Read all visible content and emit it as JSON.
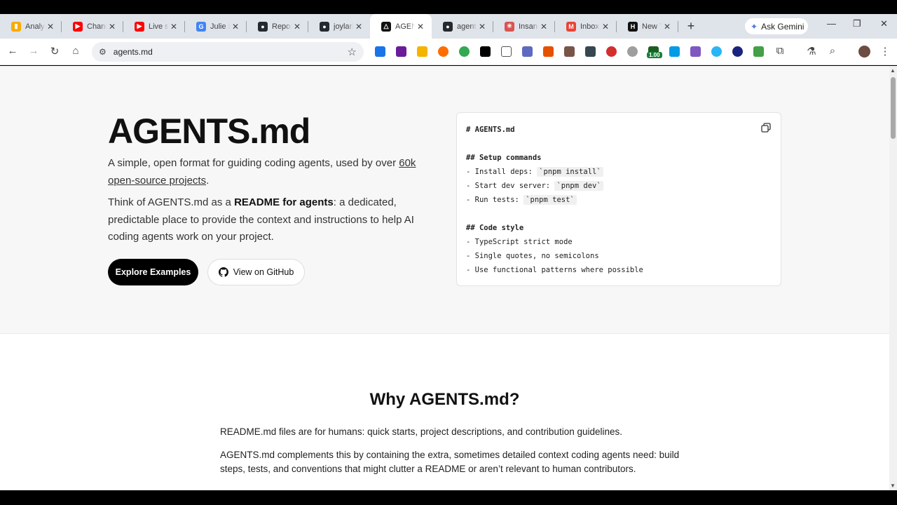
{
  "browser": {
    "tabs": [
      {
        "title": "Analytics",
        "color": "#f9ab00",
        "glyph": "▮"
      },
      {
        "title": "Channel",
        "color": "#ff0000",
        "glyph": "▶"
      },
      {
        "title": "Live stream",
        "color": "#ff0000",
        "glyph": "▶"
      },
      {
        "title": "Julie ID",
        "color": "#4285f4",
        "glyph": "G"
      },
      {
        "title": "Repository",
        "color": "#24292f",
        "glyph": "●"
      },
      {
        "title": "joylark",
        "color": "#24292f",
        "glyph": "●"
      },
      {
        "title": "AGENTS.md",
        "color": "#111111",
        "glyph": "△"
      },
      {
        "title": "agents",
        "color": "#24292f",
        "glyph": "●"
      },
      {
        "title": "Insane",
        "color": "#d9534f",
        "glyph": "✳"
      },
      {
        "title": "Inbox",
        "color": "#ea4335",
        "glyph": "M"
      },
      {
        "title": "New Tab",
        "color": "#111111",
        "glyph": "H"
      }
    ],
    "active_tab": 6,
    "ask_gemini_label": "Ask Gemini",
    "url": "agents.md",
    "extension_badge": "1.00"
  },
  "hero": {
    "title": "AGENTS.md",
    "lead_before_link": "A simple, open format for guiding coding agents, used by over ",
    "lead_link": "60k open-source projects",
    "lead_after_link": ".",
    "desc_before_bold": "Think of AGENTS.md as a ",
    "desc_bold": "README for agents",
    "desc_after_bold": ": a dedicated, predictable place to provide the context and instructions to help AI coding agents work on your project.",
    "primary_button": "Explore Examples",
    "secondary_button": "View on GitHub"
  },
  "code_sample": {
    "heading": "# AGENTS.md",
    "setup_heading": "## Setup commands",
    "setup_items": [
      {
        "prefix": "- Install deps: ",
        "code": "`pnpm install`"
      },
      {
        "prefix": "- Start dev server: ",
        "code": "`pnpm dev`"
      },
      {
        "prefix": "- Run tests: ",
        "code": "`pnpm test`"
      }
    ],
    "style_heading": "## Code style",
    "style_items": [
      "- TypeScript strict mode",
      "- Single quotes, no semicolons",
      "- Use functional patterns where possible"
    ]
  },
  "why": {
    "title": "Why AGENTS.md?",
    "p1": "README.md files are for humans: quick starts, project descriptions, and contribution guidelines.",
    "p2": "AGENTS.md complements this by containing the extra, sometimes detailed context coding agents need: build steps, tests, and conventions that might clutter a README or aren’t relevant to human contributors."
  }
}
